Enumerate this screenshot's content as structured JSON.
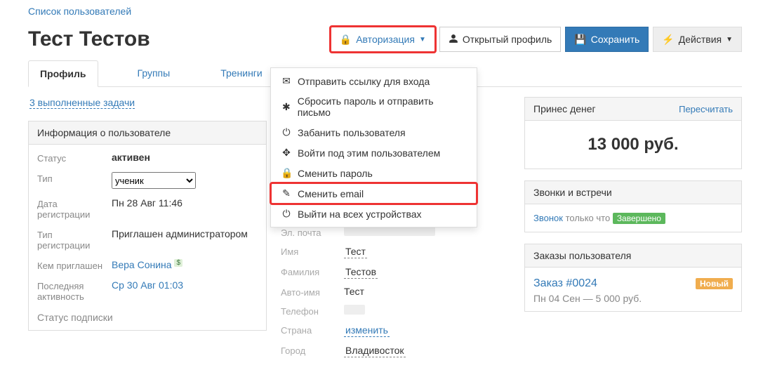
{
  "breadcrumb": {
    "users_list": "Список пользователей"
  },
  "header": {
    "title": "Тест Тестов",
    "auth_label": "Авторизация",
    "open_profile": "Открытый профиль",
    "save": "Сохранить",
    "actions": "Действия"
  },
  "tabs": {
    "profile": "Профиль",
    "groups": "Группы",
    "trainings": "Тренинги"
  },
  "auth_menu": {
    "items": [
      {
        "icon": "✉",
        "label": "Отправить ссылку для входа"
      },
      {
        "icon": "✱",
        "label": "Сбросить пароль и отправить письмо"
      },
      {
        "icon": "⏻",
        "label": "Забанить пользователя"
      },
      {
        "icon": "✥",
        "label": "Войти под этим пользователем"
      },
      {
        "icon": "🔒",
        "label": "Сменить пароль"
      },
      {
        "icon": "✎",
        "label": "Сменить email"
      },
      {
        "icon": "⏻",
        "label": "Выйти на всех устройствах"
      }
    ]
  },
  "done_tasks": "3 выполненные задачи",
  "user_info": {
    "panel_title": "Информация о пользователе",
    "status_label": "Статус",
    "status_value": "активен",
    "type_label": "Тип",
    "type_value": "ученик",
    "regdate_label": "Дата регистрации",
    "regdate_value": "Пн 28 Авг 11:46",
    "regtype_label": "Тип регистрации",
    "regtype_value": "Приглашен администратором",
    "invitedby_label": "Кем приглашен",
    "invitedby_value": "Вера Сонина",
    "lastact_label": "Последняя активность",
    "lastact_value": "Ср 30 Авг 01:03",
    "sub_status_label": "Статус подписки"
  },
  "profile": {
    "name_title": "Тест Тестов",
    "email_label": "Эл. почта",
    "first_label": "Имя",
    "first_value": "Тест",
    "last_label": "Фамилия",
    "last_value": "Тестов",
    "autoname_label": "Авто-имя",
    "autoname_value": "Тест",
    "phone_label": "Телефон",
    "country_label": "Страна",
    "country_change": "изменить",
    "city_label": "Город",
    "city_value": "Владивосток"
  },
  "money": {
    "panel_title": "Принес денег",
    "recalc": "Пересчитать",
    "amount": "13 000 руб."
  },
  "calls": {
    "panel_title": "Звонки и встречи",
    "call_link": "Звонок",
    "when": "только что",
    "status": "Завершено"
  },
  "orders": {
    "panel_title": "Заказы пользователя",
    "order_link": "Заказ #0024",
    "new_badge": "Новый",
    "details": "Пн 04 Сен — 5 000 руб."
  }
}
